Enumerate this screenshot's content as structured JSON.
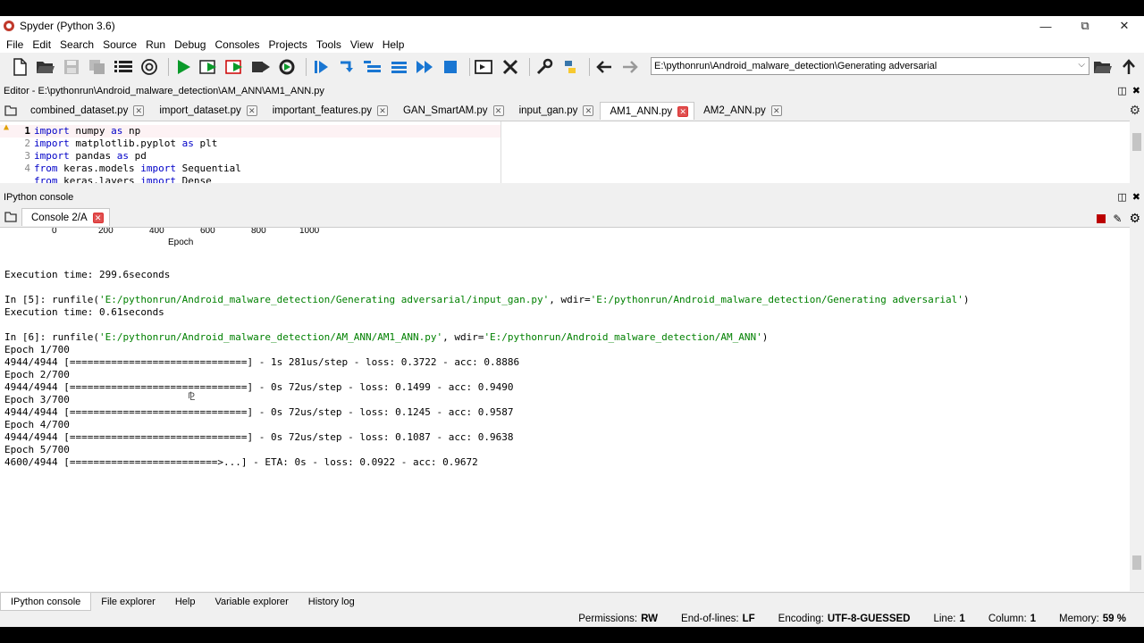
{
  "window": {
    "title": "Spyder (Python 3.6)",
    "minimize": "—",
    "maximize": "⧉",
    "close": "✕"
  },
  "menu": [
    "File",
    "Edit",
    "Search",
    "Source",
    "Run",
    "Debug",
    "Consoles",
    "Projects",
    "Tools",
    "View",
    "Help"
  ],
  "toolbar": {
    "path": "E:\\pythonrun\\Android_malware_detection\\Generating adversarial"
  },
  "editor": {
    "pane_title": "Editor - E:\\pythonrun\\Android_malware_detection\\AM_ANN\\AM1_ANN.py",
    "tabs": [
      "combined_dataset.py",
      "import_dataset.py",
      "important_features.py",
      "GAN_SmartAM.py",
      "input_gan.py",
      "AM1_ANN.py",
      "AM2_ANN.py"
    ],
    "active_tab_index": 5,
    "lines": [
      {
        "n": "1",
        "kw1": "import",
        "rest1": " numpy ",
        "kw2": "as",
        "rest2": " np"
      },
      {
        "n": "2",
        "kw1": "import",
        "rest1": " matplotlib.pyplot ",
        "kw2": "as",
        "rest2": " plt"
      },
      {
        "n": "3",
        "kw1": "import",
        "rest1": " pandas ",
        "kw2": "as",
        "rest2": " pd"
      },
      {
        "n": "4",
        "kw1": "from",
        "rest1": " keras.models ",
        "kw2": "import",
        "rest2": " Sequential"
      },
      {
        "n": "",
        "kw1": "from",
        "rest1": " keras.layers ",
        "kw2": "import",
        "rest2": " Dense"
      }
    ]
  },
  "console": {
    "pane_title": "IPython console",
    "tab": "Console 2/A",
    "axis_ticks": [
      "0",
      "200",
      "400",
      "600",
      "800",
      "1000"
    ],
    "axis_label": "Epoch",
    "lines": {
      "exec1": "Execution time: 299.6seconds",
      "in5_prompt": "In [5]: runfile(",
      "in5_file": "'E:/pythonrun/Android_malware_detection/Generating adversarial/input_gan.py'",
      "in5_mid": ", wdir=",
      "in5_wdir": "'E:/pythonrun/Android_malware_detection/Generating adversarial'",
      "in5_end": ")",
      "exec2": "Execution time: 0.61seconds",
      "in6_prompt": "In [6]: runfile(",
      "in6_file": "'E:/pythonrun/Android_malware_detection/AM_ANN/AM1_ANN.py'",
      "in6_mid": ", wdir=",
      "in6_wdir": "'E:/pythonrun/Android_malware_detection/AM_ANN'",
      "in6_end": ")",
      "e1": "Epoch 1/700",
      "p1": "4944/4944 [==============================] - 1s 281us/step - loss: 0.3722 - acc: 0.8886",
      "e2": "Epoch 2/700",
      "p2": "4944/4944 [==============================] - 0s 72us/step - loss: 0.1499 - acc: 0.9490",
      "e3": "Epoch 3/700",
      "p3": "4944/4944 [==============================] - 0s 72us/step - loss: 0.1245 - acc: 0.9587",
      "e4": "Epoch 4/700",
      "p4": "4944/4944 [==============================] - 0s 72us/step - loss: 0.1087 - acc: 0.9638",
      "e5": "Epoch 5/700",
      "p5": "4600/4944 [=========================>...] - ETA: 0s - loss: 0.0922 - acc: 0.9672"
    }
  },
  "bottom_tabs": [
    "IPython console",
    "File explorer",
    "Help",
    "Variable explorer",
    "History log"
  ],
  "status": {
    "permissions_label": "Permissions:",
    "permissions": "RW",
    "eol_label": "End-of-lines:",
    "eol": "LF",
    "encoding_label": "Encoding:",
    "encoding": "UTF-8-GUESSED",
    "line_label": "Line:",
    "line": "1",
    "column_label": "Column:",
    "column": "1",
    "memory_label": "Memory:",
    "memory": "59 %"
  }
}
